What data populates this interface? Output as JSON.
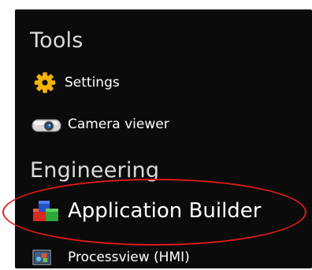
{
  "sections": [
    {
      "title": "Tools",
      "items": [
        {
          "label": "Settings",
          "icon": "gear-icon"
        },
        {
          "label": "Camera viewer",
          "icon": "camera-icon"
        }
      ]
    },
    {
      "title": "Engineering",
      "items": [
        {
          "label": "Application Builder",
          "icon": "cubes-icon"
        },
        {
          "label": "Processview (HMI)",
          "icon": "processview-icon"
        }
      ]
    }
  ],
  "colors": {
    "panel_background": "#0b0b0b",
    "section_title": "#dcdcdc",
    "item_text": "#ffffff",
    "highlight": "#e01a1a"
  }
}
